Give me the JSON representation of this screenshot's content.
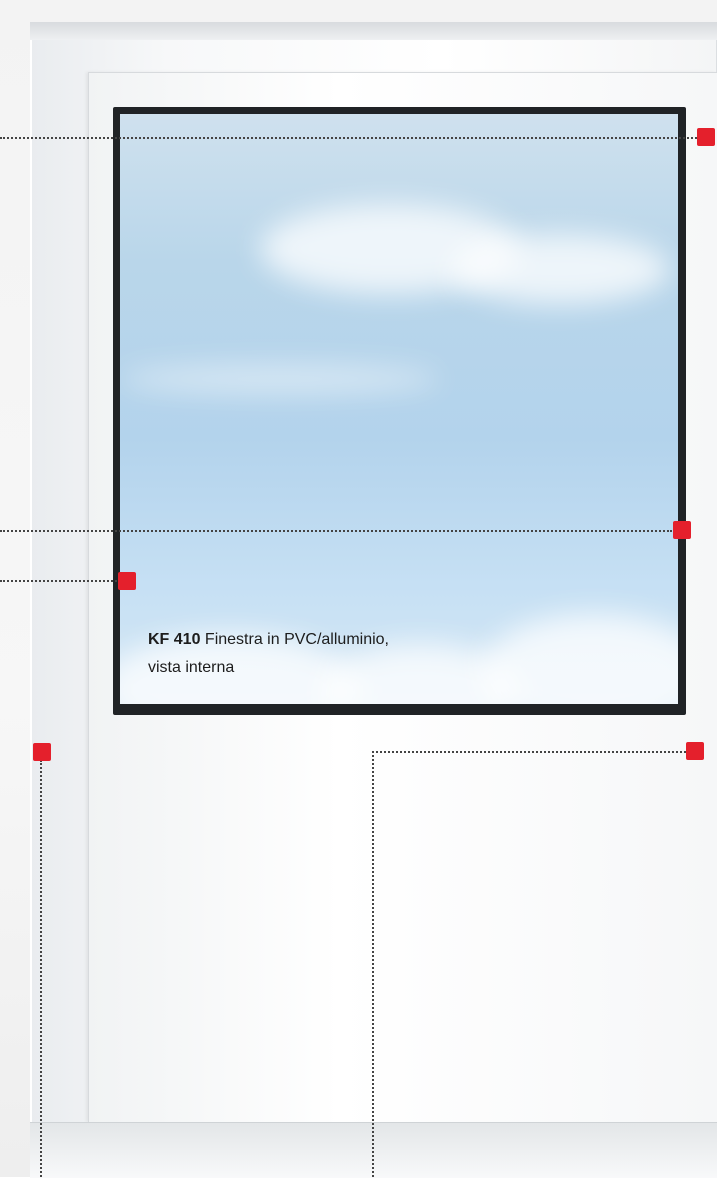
{
  "caption": {
    "model": "KF 410",
    "line1": "Finestra in PVC/alluminio,",
    "line2": "vista interna"
  },
  "colors": {
    "marker": "#e4202c",
    "callout_line": "#444444",
    "glass_sky": "#b9d6ea"
  },
  "callouts": [
    {
      "name": "top-right-marker"
    },
    {
      "name": "middle-right-marker"
    },
    {
      "name": "glass-corner-marker"
    },
    {
      "name": "frame-corner-marker"
    },
    {
      "name": "sill-right-marker"
    }
  ]
}
